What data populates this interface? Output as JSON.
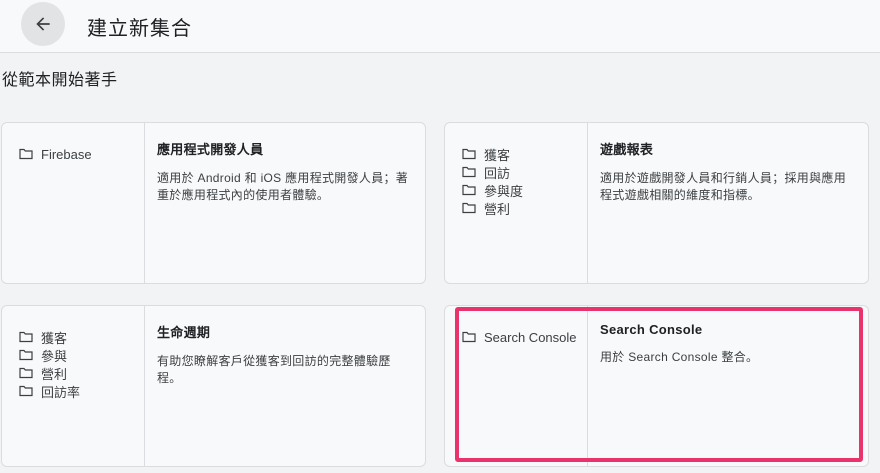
{
  "header": {
    "back_icon": "arrow-back-icon",
    "title": "建立新集合"
  },
  "section": {
    "title": "從範本開始著手"
  },
  "cards": [
    {
      "dimensions": [
        "Firebase"
      ],
      "title": "應用程式開發人員",
      "description": "適用於 Android 和 iOS 應用程式開發人員；著重於應用程式內的使用者體驗。"
    },
    {
      "dimensions": [
        "獲客",
        "回訪",
        "參與度",
        "營利"
      ],
      "title": "遊戲報表",
      "description": "適用於遊戲開發人員和行銷人員；採用與應用程式遊戲相關的維度和指標。"
    },
    {
      "dimensions": [
        "獲客",
        "參與",
        "營利",
        "回訪率"
      ],
      "title": "生命週期",
      "description": "有助您瞭解客戶從獲客到回訪的完整體驗歷程。"
    },
    {
      "dimensions": [
        "Search Console"
      ],
      "title": "Search Console",
      "description": "用於 Search Console 整合。"
    }
  ],
  "highlight_color": "#e8336d"
}
